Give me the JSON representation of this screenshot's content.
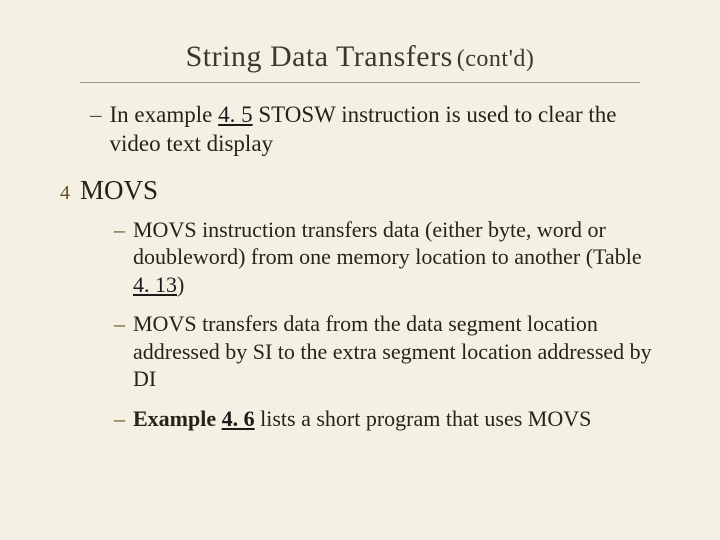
{
  "title": {
    "main": "String Data Transfers",
    "sub": "(cont'd)"
  },
  "items": {
    "intro_dash": "–",
    "intro_text_1": "In example ",
    "intro_link_1": "4. 5",
    "intro_text_2": " STOSW instruction is used to clear the video text display",
    "main_bullet": "4",
    "main_label": "MOVS",
    "sub1_dash": "–",
    "sub1_text_1": "MOVS instruction transfers data (either byte, word or doubleword)  from one memory loca­tion to another  (Table ",
    "sub1_link": "4. 13",
    "sub1_text_2": ")",
    "sub2_dash": "–",
    "sub2_text": "MOVS transfers data from the data segment location addressed by SI to the extra segment location addressed by DI",
    "sub3_dash": "–",
    "sub3_bold_1": "Example ",
    "sub3_link": "4. 6",
    "sub3_text_1": " lists a ",
    "sub3_text_2": "short ",
    "sub3_text_3": "program ",
    "sub3_text_4": "that ",
    "sub3_text_5": "uses MOVS"
  }
}
